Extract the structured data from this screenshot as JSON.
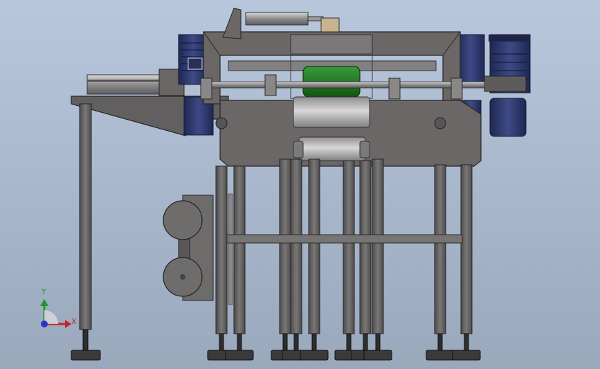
{
  "view": {
    "background_top": "#b8c7dc",
    "background_bottom": "#9aa8bc"
  },
  "triad": {
    "y_label": "Y",
    "x_label": "X",
    "y_color": "#1d9a24",
    "x_color": "#c0262d",
    "origin_color": "#2a33c8"
  },
  "colors": {
    "frame_steel": "#6a6766",
    "frame_dark": "#4a4848",
    "motor_blue": "#2f3a6e",
    "roller_light": "#bfbfbf",
    "hopper_green": "#1f7a1f"
  }
}
